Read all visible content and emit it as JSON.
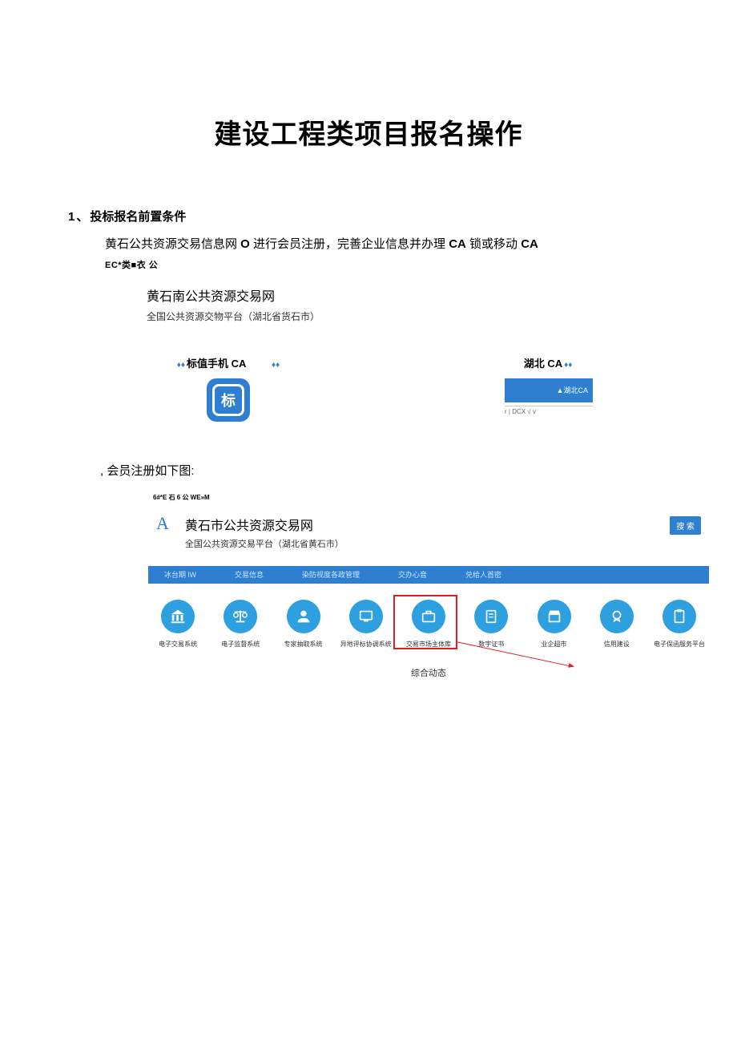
{
  "title": "建设工程类项目报名操作",
  "section1": {
    "num": "1",
    "sep": "、",
    "heading": "投标报名前置条件",
    "line1_a": "黄石公共资源交易信息网 ",
    "line1_b": "O",
    "line1_c": " 进行会员注册，完善企业信息并办理 ",
    "line1_d": "CA",
    "line1_e": " 锁或移动 ",
    "line1_f": "CA",
    "garble": "EC*类■衣 公"
  },
  "site1": {
    "title": "黄石南公共资源交易网",
    "sub": "全国公共资源交物平台（湖北省货石市）"
  },
  "ca": {
    "label_left_a": "标值手机 ",
    "label_left_b": "CA",
    "left_glyph": "标",
    "label_right_a": "湖北 ",
    "label_right_b": "CA",
    "right_tag": "▲湖北CA",
    "right_bar": "r | DCX √ v"
  },
  "instr": ", 会员注册如下图:",
  "ss2": {
    "top_garble": "6#*E 石 6 公 WE»M",
    "logo": "A",
    "title": "黄石市公共资源交易网",
    "sub": "全国公共资源交易平台（湖北省黄石市）",
    "search": "搜 索",
    "nav": [
      "冰台期 lW",
      "交易信息",
      "染防视度各政管理",
      "交办心音",
      "兑给人首密"
    ],
    "icons": [
      "电子交易系统",
      "电子监督系统",
      "专家抽取系统",
      "异地评标协调系统",
      "交易市场主体库",
      "数字证书",
      "业企超市",
      "信用建设",
      "电子保函服务平台"
    ],
    "footer": "综合动态"
  }
}
